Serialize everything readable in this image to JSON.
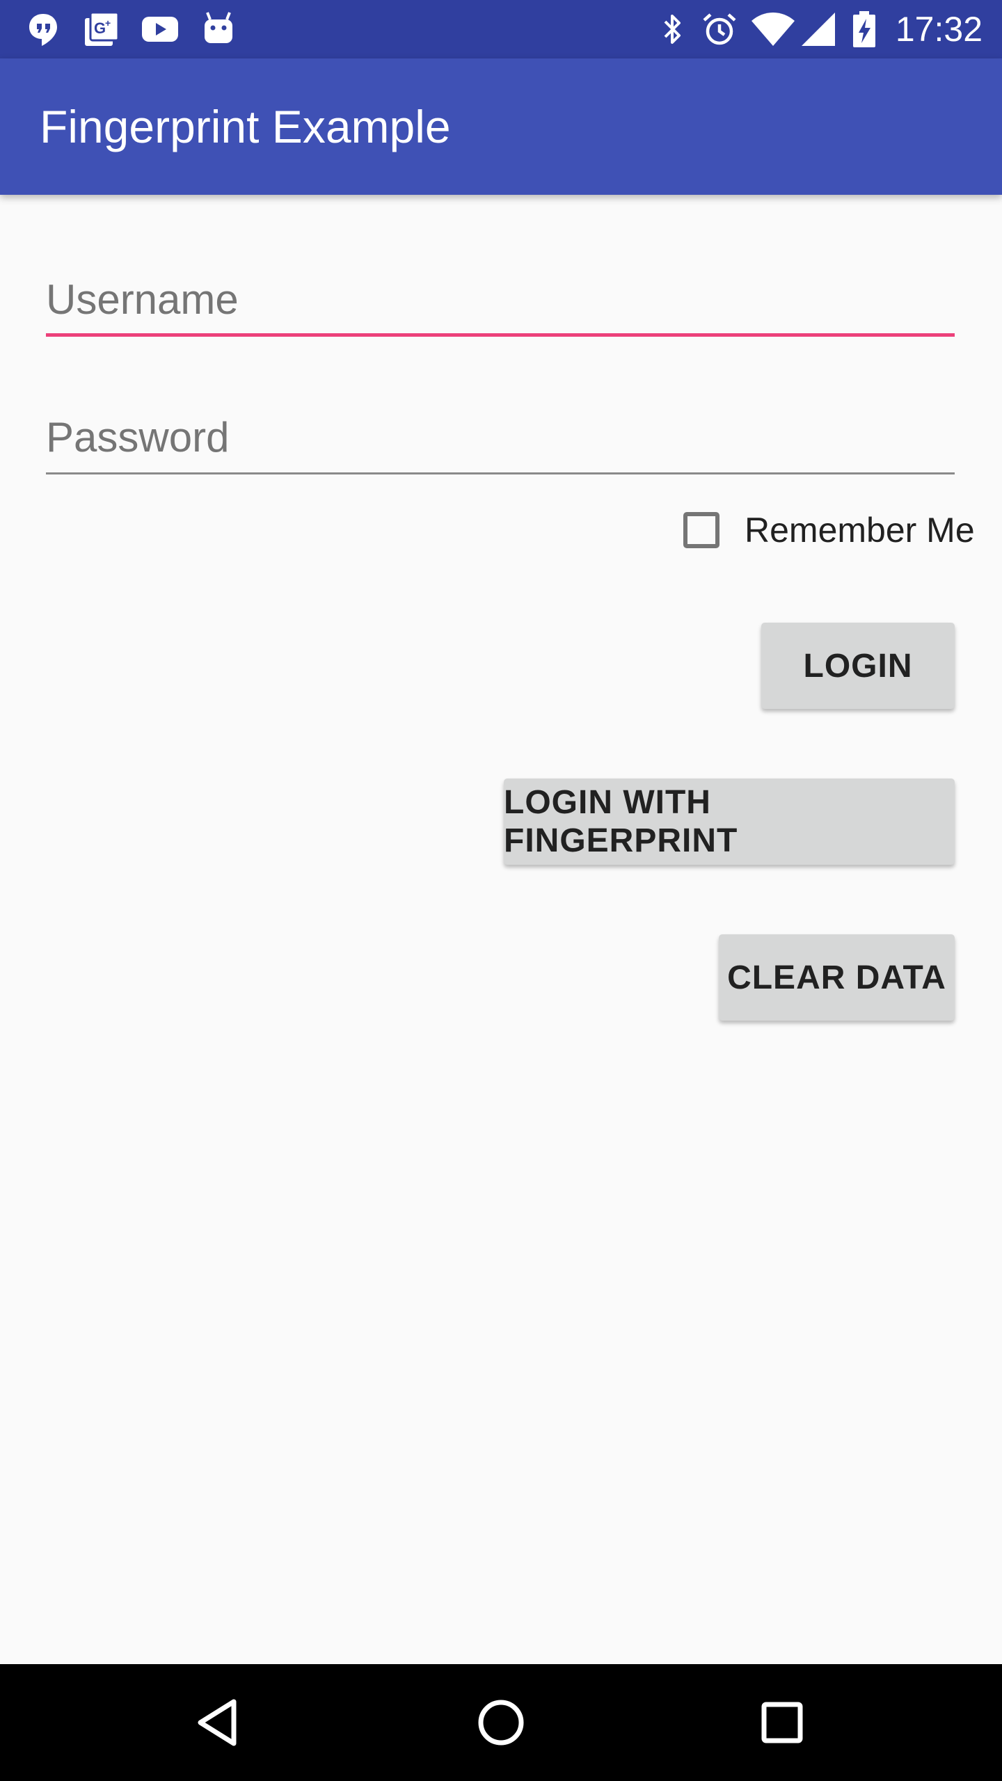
{
  "status_bar": {
    "time": "17:32",
    "left_icons": [
      "hangouts-icon",
      "google-plus-icon",
      "youtube-icon",
      "android-icon"
    ],
    "right_icons": [
      "bluetooth-icon",
      "alarm-icon",
      "wifi-icon",
      "cell-signal-icon",
      "battery-charging-icon"
    ]
  },
  "app_bar": {
    "title": "Fingerprint Example",
    "color": "#3f51b5"
  },
  "form": {
    "username": {
      "placeholder": "Username",
      "value": ""
    },
    "password": {
      "placeholder": "Password",
      "value": ""
    },
    "remember_me": {
      "label": "Remember Me",
      "checked": false
    }
  },
  "buttons": {
    "login": "LOGIN",
    "login_fingerprint": "LOGIN WITH FINGERPRINT",
    "clear_data": "CLEAR DATA"
  },
  "nav_bar": {
    "icons": [
      "back-icon",
      "home-icon",
      "recents-icon"
    ]
  },
  "colors": {
    "status_bar": "#303f9f",
    "accent": "#ec407a",
    "button": "#d6d7d7",
    "background": "#fafafa"
  }
}
